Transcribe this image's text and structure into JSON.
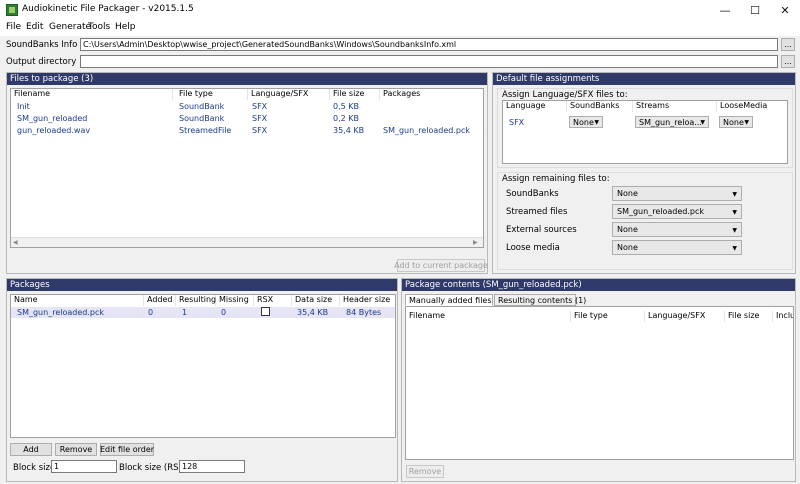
{
  "window": {
    "title": "Audiokinetic File Packager - v2015.1.5",
    "minimize": "—",
    "maximize": "☐",
    "close": "✕"
  },
  "menu": [
    "File",
    "Edit",
    "Generate",
    "Tools",
    "Help"
  ],
  "soundbanks_info": {
    "label": "SoundBanks Info file",
    "value": "C:\\Users\\Admin\\Desktop\\wwise_project\\GeneratedSoundBanks\\Windows\\SoundbanksInfo.xml",
    "browse": "..."
  },
  "output_dir": {
    "label": "Output directory",
    "value": "",
    "browse": "..."
  },
  "files_panel": {
    "title": "Files to package (3)",
    "columns": [
      "Filename",
      "File type",
      "Language/SFX",
      "File size",
      "Packages"
    ],
    "rows": [
      [
        "Init",
        "SoundBank",
        "SFX",
        "0,5 KB",
        ""
      ],
      [
        "SM_gun_reloaded",
        "SoundBank",
        "SFX",
        "0,2 KB",
        ""
      ],
      [
        "gun_reloaded.wav",
        "StreamedFile",
        "SFX",
        "35,4 KB",
        "SM_gun_reloaded.pck"
      ]
    ],
    "add_button": "Add to current package"
  },
  "defaults_panel": {
    "title": "Default file assignments",
    "assign_lang_label": "Assign Language/SFX files to:",
    "columns": [
      "Language",
      "SoundBanks",
      "Streams",
      "LooseMedia"
    ],
    "row": {
      "language": "SFX",
      "soundbanks": "None",
      "streams": "SM_gun_reloa...",
      "loosemedia": "None"
    },
    "remaining_label": "Assign remaining files to:",
    "remaining": [
      {
        "label": "SoundBanks",
        "value": "None"
      },
      {
        "label": "Streamed files",
        "value": "SM_gun_reloaded.pck"
      },
      {
        "label": "External sources",
        "value": "None"
      },
      {
        "label": "Loose media",
        "value": "None"
      }
    ]
  },
  "packages_panel": {
    "title": "Packages",
    "columns": [
      "Name",
      "Added",
      "Resulting",
      "Missing",
      "RSX",
      "Data size",
      "Header size"
    ],
    "rows": [
      [
        "SM_gun_reloaded.pck",
        "0",
        "1",
        "0",
        "",
        "35,4 KB",
        "84 Bytes"
      ]
    ],
    "add": "Add",
    "remove": "Remove",
    "edit_order": "Edit file order",
    "block_size_label": "Block size:",
    "block_size": "1",
    "block_size_rsx_label": "Block size (RSX):",
    "block_size_rsx": "128"
  },
  "contents_panel": {
    "title": "Package contents (SM_gun_reloaded.pck)",
    "tabs": [
      "Manually added files (0)",
      "Resulting contents (1)"
    ],
    "columns": [
      "Filename",
      "File type",
      "Language/SFX",
      "File size",
      "Inclu"
    ],
    "remove": "Remove"
  }
}
